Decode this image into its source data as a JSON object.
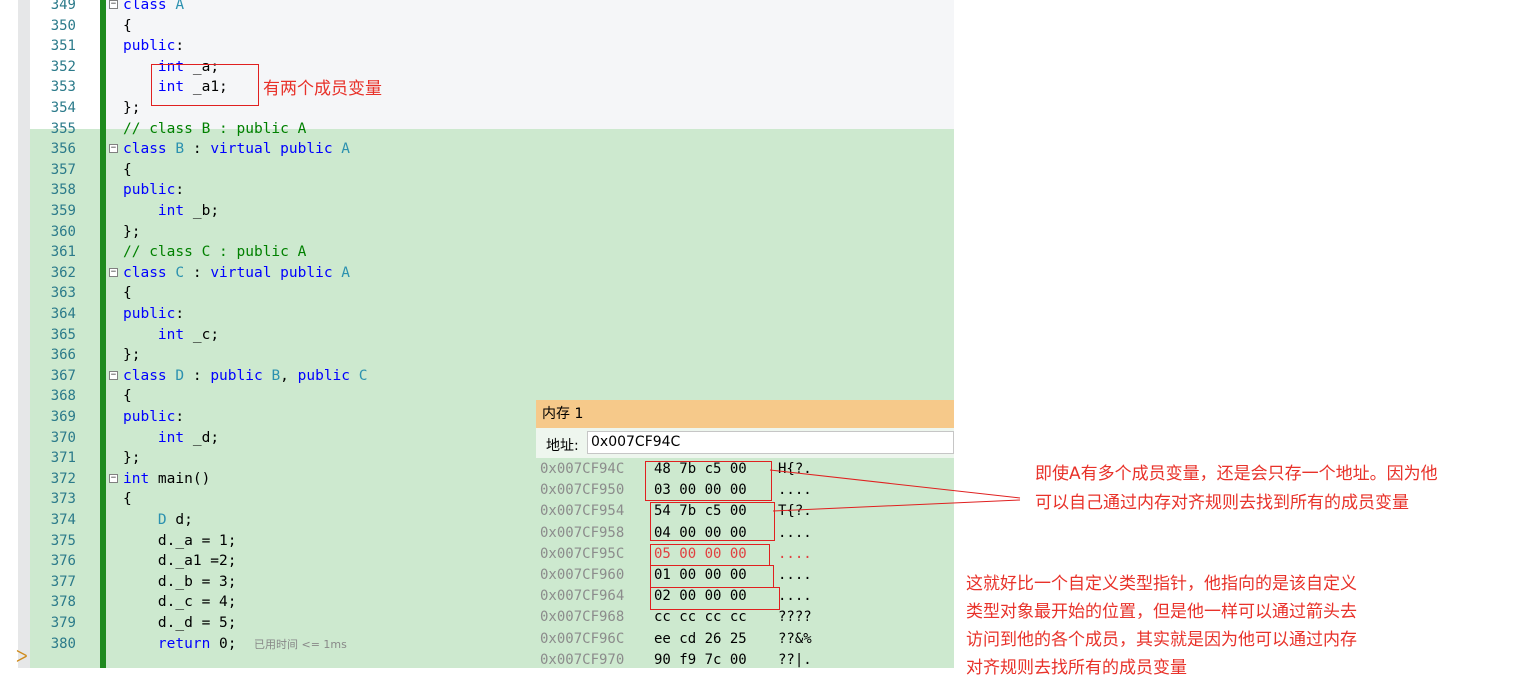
{
  "code_lines": [
    {
      "ln": "349",
      "parts": [
        {
          "t": "class ",
          "c": "kw"
        },
        {
          "t": "A",
          "c": "ty"
        }
      ],
      "fold": true
    },
    {
      "ln": "350",
      "parts": [
        {
          "t": "{",
          "c": ""
        }
      ]
    },
    {
      "ln": "351",
      "parts": [
        {
          "t": "public",
          "c": "kw"
        },
        {
          "t": ":",
          "c": ""
        }
      ]
    },
    {
      "ln": "352",
      "parts": [
        {
          "t": "    ",
          "c": ""
        },
        {
          "t": "int",
          "c": "kw"
        },
        {
          "t": " _a;",
          "c": ""
        }
      ]
    },
    {
      "ln": "353",
      "parts": [
        {
          "t": "    ",
          "c": ""
        },
        {
          "t": "int",
          "c": "kw"
        },
        {
          "t": " _a1;",
          "c": ""
        }
      ]
    },
    {
      "ln": "354",
      "parts": [
        {
          "t": "};",
          "c": ""
        }
      ]
    },
    {
      "ln": "355",
      "parts": [
        {
          "t": "// class B : public A",
          "c": "cm"
        }
      ]
    },
    {
      "ln": "356",
      "parts": [
        {
          "t": "class ",
          "c": "kw"
        },
        {
          "t": "B",
          "c": "ty"
        },
        {
          "t": " : ",
          "c": ""
        },
        {
          "t": "virtual public ",
          "c": "kw"
        },
        {
          "t": "A",
          "c": "ty"
        }
      ],
      "fold": true
    },
    {
      "ln": "357",
      "parts": [
        {
          "t": "{",
          "c": ""
        }
      ]
    },
    {
      "ln": "358",
      "parts": [
        {
          "t": "public",
          "c": "kw"
        },
        {
          "t": ":",
          "c": ""
        }
      ]
    },
    {
      "ln": "359",
      "parts": [
        {
          "t": "    ",
          "c": ""
        },
        {
          "t": "int",
          "c": "kw"
        },
        {
          "t": " _b;",
          "c": ""
        }
      ]
    },
    {
      "ln": "360",
      "parts": [
        {
          "t": "};",
          "c": ""
        }
      ]
    },
    {
      "ln": "361",
      "parts": [
        {
          "t": "// class C : public A",
          "c": "cm"
        }
      ]
    },
    {
      "ln": "362",
      "parts": [
        {
          "t": "class ",
          "c": "kw"
        },
        {
          "t": "C",
          "c": "ty"
        },
        {
          "t": " : ",
          "c": ""
        },
        {
          "t": "virtual public ",
          "c": "kw"
        },
        {
          "t": "A",
          "c": "ty"
        }
      ],
      "fold": true
    },
    {
      "ln": "363",
      "parts": [
        {
          "t": "{",
          "c": ""
        }
      ]
    },
    {
      "ln": "364",
      "parts": [
        {
          "t": "public",
          "c": "kw"
        },
        {
          "t": ":",
          "c": ""
        }
      ]
    },
    {
      "ln": "365",
      "parts": [
        {
          "t": "    ",
          "c": ""
        },
        {
          "t": "int",
          "c": "kw"
        },
        {
          "t": " _c;",
          "c": ""
        }
      ]
    },
    {
      "ln": "366",
      "parts": [
        {
          "t": "};",
          "c": ""
        }
      ]
    },
    {
      "ln": "367",
      "parts": [
        {
          "t": "class ",
          "c": "kw"
        },
        {
          "t": "D",
          "c": "ty"
        },
        {
          "t": " : ",
          "c": ""
        },
        {
          "t": "public ",
          "c": "kw"
        },
        {
          "t": "B",
          "c": "ty"
        },
        {
          "t": ", ",
          "c": ""
        },
        {
          "t": "public ",
          "c": "kw"
        },
        {
          "t": "C",
          "c": "ty"
        }
      ],
      "fold": true
    },
    {
      "ln": "368",
      "parts": [
        {
          "t": "{",
          "c": ""
        }
      ]
    },
    {
      "ln": "369",
      "parts": [
        {
          "t": "public",
          "c": "kw"
        },
        {
          "t": ":",
          "c": ""
        }
      ]
    },
    {
      "ln": "370",
      "parts": [
        {
          "t": "    ",
          "c": ""
        },
        {
          "t": "int",
          "c": "kw"
        },
        {
          "t": " _d;",
          "c": ""
        }
      ]
    },
    {
      "ln": "371",
      "parts": [
        {
          "t": "};",
          "c": ""
        }
      ]
    },
    {
      "ln": "372",
      "parts": [
        {
          "t": "int",
          "c": "kw"
        },
        {
          "t": " main()",
          "c": ""
        }
      ],
      "fold": true
    },
    {
      "ln": "373",
      "parts": [
        {
          "t": "{",
          "c": ""
        }
      ]
    },
    {
      "ln": "374",
      "parts": [
        {
          "t": "    ",
          "c": ""
        },
        {
          "t": "D",
          "c": "ty"
        },
        {
          "t": " d;",
          "c": ""
        }
      ]
    },
    {
      "ln": "375",
      "parts": [
        {
          "t": "    d._a = 1;",
          "c": ""
        }
      ]
    },
    {
      "ln": "376",
      "parts": [
        {
          "t": "    d._a1 =2;",
          "c": ""
        }
      ]
    },
    {
      "ln": "377",
      "parts": [
        {
          "t": "    d._b = 3;",
          "c": ""
        }
      ]
    },
    {
      "ln": "378",
      "parts": [
        {
          "t": "    d._c = 4;",
          "c": ""
        }
      ]
    },
    {
      "ln": "379",
      "parts": [
        {
          "t": "    d._d = 5;",
          "c": ""
        }
      ]
    },
    {
      "ln": "380",
      "parts": [
        {
          "t": "    ",
          "c": ""
        },
        {
          "t": "return",
          "c": "kw"
        },
        {
          "t": " 0;",
          "c": ""
        }
      ]
    }
  ],
  "elapsed_label": "已用时间 <= 1ms",
  "current_line_marker": "ᐳ",
  "annotation_members": "有两个成员变量",
  "annotation_address": "即使A有多个成员变量，还是会只存一个地址。因为他可以自己通过内存对齐规则去找到所有的成员变量",
  "annotation_address_lines": [
    "即使A有多个成员变量，还是会只存一个地址。因为他",
    "可以自己通过内存对齐规则去找到所有的成员变量"
  ],
  "annotation_pointer_lines": [
    "这就好比一个自定义类型指针，他指向的是该自定义",
    "类型对象最开始的位置，但是他一样可以通过箭头去",
    "访问到他的各个成员，其实就是因为他可以通过内存",
    "对齐规则去找所有的成员变量"
  ],
  "memory_window": {
    "title": "内存 1",
    "address_label": "地址:",
    "address_value": "0x007CF94C",
    "rows": [
      {
        "addr": "0x007CF94C",
        "bytes": "48 7b c5 00",
        "ascii": "H{?.",
        "red": false
      },
      {
        "addr": "0x007CF950",
        "bytes": "03 00 00 00",
        "ascii": "....",
        "red": false
      },
      {
        "addr": "0x007CF954",
        "bytes": "54 7b c5 00",
        "ascii": "T{?.",
        "red": false
      },
      {
        "addr": "0x007CF958",
        "bytes": "04 00 00 00",
        "ascii": "....",
        "red": false
      },
      {
        "addr": "0x007CF95C",
        "bytes": "05 00 00 00",
        "ascii": "....",
        "red": true
      },
      {
        "addr": "0x007CF960",
        "bytes": "01 00 00 00",
        "ascii": "....",
        "red": false
      },
      {
        "addr": "0x007CF964",
        "bytes": "02 00 00 00",
        "ascii": "....",
        "red": false
      },
      {
        "addr": "0x007CF968",
        "bytes": "cc cc cc cc",
        "ascii": "????",
        "red": false
      },
      {
        "addr": "0x007CF96C",
        "bytes": "ee cd 26 25",
        "ascii": "??&%",
        "red": false
      },
      {
        "addr": "0x007CF970",
        "bytes": "90 f9 7c 00",
        "ascii": "??|.",
        "red": false
      }
    ]
  },
  "colors": {
    "keyword": "#0000ff",
    "type": "#2b91af",
    "comment": "#008000",
    "annotation": "#e8322a",
    "memory_title_bg": "#f6c98a",
    "changed_lines_bg": "#cde9cf"
  }
}
